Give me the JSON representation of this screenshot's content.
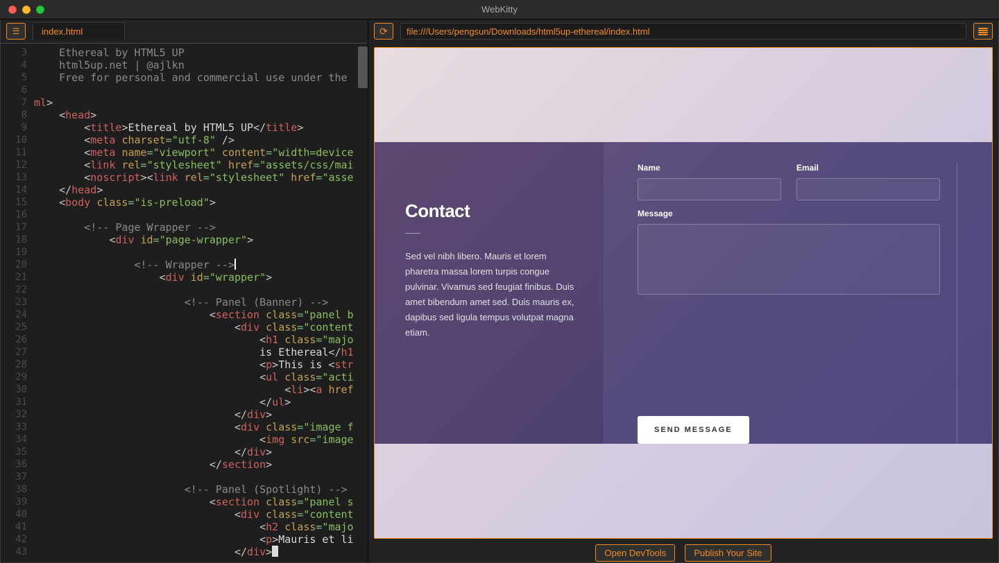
{
  "window": {
    "title": "WebKitty"
  },
  "leftbar": {
    "tab": "index.html"
  },
  "rightbar": {
    "url": "file:///Users/pengsun/Downloads/html5up-ethereal/index.html"
  },
  "bottom": {
    "devtools": "Open DevTools",
    "publish": "Publish Your Site"
  },
  "code": {
    "lines": [
      {
        "n": 3,
        "tokens": [
          [
            "    ",
            "comment"
          ],
          [
            "Ethereal by HTML5 UP",
            "comment"
          ]
        ]
      },
      {
        "n": 4,
        "tokens": [
          [
            "    ",
            "comment"
          ],
          [
            "html5up.net | @ajlkn",
            "comment"
          ]
        ]
      },
      {
        "n": 5,
        "tokens": [
          [
            "    ",
            "comment"
          ],
          [
            "Free for personal and commercial use under the",
            "comment"
          ]
        ]
      },
      {
        "n": 6,
        "tokens": []
      },
      {
        "n": 7,
        "tokens": [
          [
            "ml",
            "tag"
          ],
          [
            ">",
            "bracket"
          ]
        ]
      },
      {
        "n": 8,
        "tokens": [
          [
            "    <",
            "bracket"
          ],
          [
            "head",
            "tag"
          ],
          [
            ">",
            "bracket"
          ]
        ]
      },
      {
        "n": 9,
        "tokens": [
          [
            "        <",
            "bracket"
          ],
          [
            "title",
            "tag"
          ],
          [
            ">",
            "bracket"
          ],
          [
            "Ethereal by HTML5 UP",
            "text"
          ],
          [
            "</",
            "bracket"
          ],
          [
            "title",
            "tag"
          ],
          [
            ">",
            "bracket"
          ]
        ]
      },
      {
        "n": 10,
        "tokens": [
          [
            "        <",
            "bracket"
          ],
          [
            "meta",
            "tag"
          ],
          [
            " ",
            "text"
          ],
          [
            "charset",
            "attr"
          ],
          [
            "=",
            "eq"
          ],
          [
            "\"utf-8\"",
            "str"
          ],
          [
            " />",
            "bracket"
          ]
        ]
      },
      {
        "n": 11,
        "tokens": [
          [
            "        <",
            "bracket"
          ],
          [
            "meta",
            "tag"
          ],
          [
            " ",
            "text"
          ],
          [
            "name",
            "attr"
          ],
          [
            "=",
            "eq"
          ],
          [
            "\"viewport\"",
            "str"
          ],
          [
            " ",
            "text"
          ],
          [
            "content",
            "attr"
          ],
          [
            "=",
            "eq"
          ],
          [
            "\"width=device",
            "str"
          ]
        ]
      },
      {
        "n": 12,
        "tokens": [
          [
            "        <",
            "bracket"
          ],
          [
            "link",
            "tag"
          ],
          [
            " ",
            "text"
          ],
          [
            "rel",
            "attr"
          ],
          [
            "=",
            "eq"
          ],
          [
            "\"stylesheet\"",
            "str"
          ],
          [
            " ",
            "text"
          ],
          [
            "href",
            "attr"
          ],
          [
            "=",
            "eq"
          ],
          [
            "\"assets/css/mai",
            "str"
          ]
        ]
      },
      {
        "n": 13,
        "tokens": [
          [
            "        <",
            "bracket"
          ],
          [
            "noscript",
            "tag"
          ],
          [
            ">",
            "bracket"
          ],
          [
            "<",
            "bracket"
          ],
          [
            "link",
            "tag"
          ],
          [
            " ",
            "text"
          ],
          [
            "rel",
            "attr"
          ],
          [
            "=",
            "eq"
          ],
          [
            "\"stylesheet\"",
            "str"
          ],
          [
            " ",
            "text"
          ],
          [
            "href",
            "attr"
          ],
          [
            "=",
            "eq"
          ],
          [
            "\"asse",
            "str"
          ]
        ]
      },
      {
        "n": 14,
        "tokens": [
          [
            "    </",
            "bracket"
          ],
          [
            "head",
            "tag"
          ],
          [
            ">",
            "bracket"
          ]
        ]
      },
      {
        "n": 15,
        "tokens": [
          [
            "    <",
            "bracket"
          ],
          [
            "body",
            "tag"
          ],
          [
            " ",
            "text"
          ],
          [
            "class",
            "attr"
          ],
          [
            "=",
            "eq"
          ],
          [
            "\"is-preload\"",
            "str"
          ],
          [
            ">",
            "bracket"
          ]
        ]
      },
      {
        "n": 16,
        "tokens": []
      },
      {
        "n": 17,
        "tokens": [
          [
            "        ",
            "text"
          ],
          [
            "<!-- Page Wrapper -->",
            "comment"
          ]
        ]
      },
      {
        "n": 18,
        "tokens": [
          [
            "            <",
            "bracket"
          ],
          [
            "div",
            "tag"
          ],
          [
            " ",
            "text"
          ],
          [
            "id",
            "attr"
          ],
          [
            "=",
            "eq"
          ],
          [
            "\"page-wrapper\"",
            "str"
          ],
          [
            ">",
            "bracket"
          ]
        ]
      },
      {
        "n": 19,
        "tokens": []
      },
      {
        "n": 20,
        "tokens": [
          [
            "                ",
            "text"
          ],
          [
            "<!-- Wrapper -->",
            "comment"
          ],
          [
            "|",
            "cursor"
          ]
        ]
      },
      {
        "n": 21,
        "tokens": [
          [
            "                    <",
            "bracket"
          ],
          [
            "div",
            "tag"
          ],
          [
            " ",
            "text"
          ],
          [
            "id",
            "attr"
          ],
          [
            "=",
            "eq"
          ],
          [
            "\"wrapper\"",
            "str"
          ],
          [
            ">",
            "bracket"
          ]
        ]
      },
      {
        "n": 22,
        "tokens": []
      },
      {
        "n": 23,
        "tokens": [
          [
            "                        ",
            "text"
          ],
          [
            "<!-- Panel (Banner) -->",
            "comment"
          ]
        ]
      },
      {
        "n": 24,
        "tokens": [
          [
            "                            <",
            "bracket"
          ],
          [
            "section",
            "tag"
          ],
          [
            " ",
            "text"
          ],
          [
            "class",
            "attr"
          ],
          [
            "=",
            "eq"
          ],
          [
            "\"panel b",
            "str"
          ]
        ]
      },
      {
        "n": 25,
        "tokens": [
          [
            "                                <",
            "bracket"
          ],
          [
            "div",
            "tag"
          ],
          [
            " ",
            "text"
          ],
          [
            "class",
            "attr"
          ],
          [
            "=",
            "eq"
          ],
          [
            "\"content",
            "str"
          ]
        ]
      },
      {
        "n": 26,
        "tokens": [
          [
            "                                    <",
            "bracket"
          ],
          [
            "h1",
            "tag"
          ],
          [
            " ",
            "text"
          ],
          [
            "class",
            "attr"
          ],
          [
            "=",
            "eq"
          ],
          [
            "\"majo",
            "str"
          ]
        ]
      },
      {
        "n": 27,
        "tokens": [
          [
            "                                    ",
            "text"
          ],
          [
            "is Ethereal",
            "text"
          ],
          [
            "</",
            "bracket"
          ],
          [
            "h1",
            "tag"
          ]
        ]
      },
      {
        "n": 28,
        "tokens": [
          [
            "                                    <",
            "bracket"
          ],
          [
            "p",
            "tag"
          ],
          [
            ">",
            "bracket"
          ],
          [
            "This is ",
            "text"
          ],
          [
            "<",
            "bracket"
          ],
          [
            "str",
            "tag"
          ]
        ]
      },
      {
        "n": 29,
        "tokens": [
          [
            "                                    <",
            "bracket"
          ],
          [
            "ul",
            "tag"
          ],
          [
            " ",
            "text"
          ],
          [
            "class",
            "attr"
          ],
          [
            "=",
            "eq"
          ],
          [
            "\"acti",
            "str"
          ]
        ]
      },
      {
        "n": 30,
        "tokens": [
          [
            "                                        <",
            "bracket"
          ],
          [
            "li",
            "tag"
          ],
          [
            ">",
            "bracket"
          ],
          [
            "<",
            "bracket"
          ],
          [
            "a",
            "tag"
          ],
          [
            " ",
            "text"
          ],
          [
            "href",
            "attr"
          ]
        ]
      },
      {
        "n": 31,
        "tokens": [
          [
            "                                    </",
            "bracket"
          ],
          [
            "ul",
            "tag"
          ],
          [
            ">",
            "bracket"
          ]
        ]
      },
      {
        "n": 32,
        "tokens": [
          [
            "                                </",
            "bracket"
          ],
          [
            "div",
            "tag"
          ],
          [
            ">",
            "bracket"
          ]
        ]
      },
      {
        "n": 33,
        "tokens": [
          [
            "                                <",
            "bracket"
          ],
          [
            "div",
            "tag"
          ],
          [
            " ",
            "text"
          ],
          [
            "class",
            "attr"
          ],
          [
            "=",
            "eq"
          ],
          [
            "\"image f",
            "str"
          ]
        ]
      },
      {
        "n": 34,
        "tokens": [
          [
            "                                    <",
            "bracket"
          ],
          [
            "img",
            "tag"
          ],
          [
            " ",
            "text"
          ],
          [
            "src",
            "attr"
          ],
          [
            "=",
            "eq"
          ],
          [
            "\"image",
            "str"
          ]
        ]
      },
      {
        "n": 35,
        "tokens": [
          [
            "                                </",
            "bracket"
          ],
          [
            "div",
            "tag"
          ],
          [
            ">",
            "bracket"
          ]
        ]
      },
      {
        "n": 36,
        "tokens": [
          [
            "                            </",
            "bracket"
          ],
          [
            "section",
            "tag"
          ],
          [
            ">",
            "bracket"
          ]
        ]
      },
      {
        "n": 37,
        "tokens": []
      },
      {
        "n": 38,
        "tokens": [
          [
            "                        ",
            "text"
          ],
          [
            "<!-- Panel (Spotlight) -->",
            "comment"
          ]
        ]
      },
      {
        "n": 39,
        "tokens": [
          [
            "                            <",
            "bracket"
          ],
          [
            "section",
            "tag"
          ],
          [
            " ",
            "text"
          ],
          [
            "class",
            "attr"
          ],
          [
            "=",
            "eq"
          ],
          [
            "\"panel s",
            "str"
          ]
        ]
      },
      {
        "n": 40,
        "tokens": [
          [
            "                                <",
            "bracket"
          ],
          [
            "div",
            "tag"
          ],
          [
            " ",
            "text"
          ],
          [
            "class",
            "attr"
          ],
          [
            "=",
            "eq"
          ],
          [
            "\"content",
            "str"
          ]
        ]
      },
      {
        "n": 41,
        "tokens": [
          [
            "                                    <",
            "bracket"
          ],
          [
            "h2",
            "tag"
          ],
          [
            " ",
            "text"
          ],
          [
            "class",
            "attr"
          ],
          [
            "=",
            "eq"
          ],
          [
            "\"majo",
            "str"
          ]
        ]
      },
      {
        "n": 42,
        "tokens": [
          [
            "                                    <",
            "bracket"
          ],
          [
            "p",
            "tag"
          ],
          [
            ">",
            "bracket"
          ],
          [
            "Mauris et li",
            "text"
          ]
        ]
      },
      {
        "n": 43,
        "tokens": [
          [
            "                                </",
            "bracket"
          ],
          [
            "div",
            "tag"
          ],
          [
            ">",
            "bracket"
          ],
          [
            "█",
            "bcursor"
          ]
        ]
      }
    ]
  },
  "preview": {
    "contact": {
      "heading": "Contact",
      "desc": "Sed vel nibh libero. Mauris et lorem pharetra massa lorem turpis congue pulvinar. Vivamus sed feugiat finibus. Duis amet bibendum amet sed. Duis mauris ex, dapibus sed ligula tempus volutpat magna etiam.",
      "name_label": "Name",
      "email_label": "Email",
      "message_label": "Message",
      "send": "SEND MESSAGE"
    }
  }
}
